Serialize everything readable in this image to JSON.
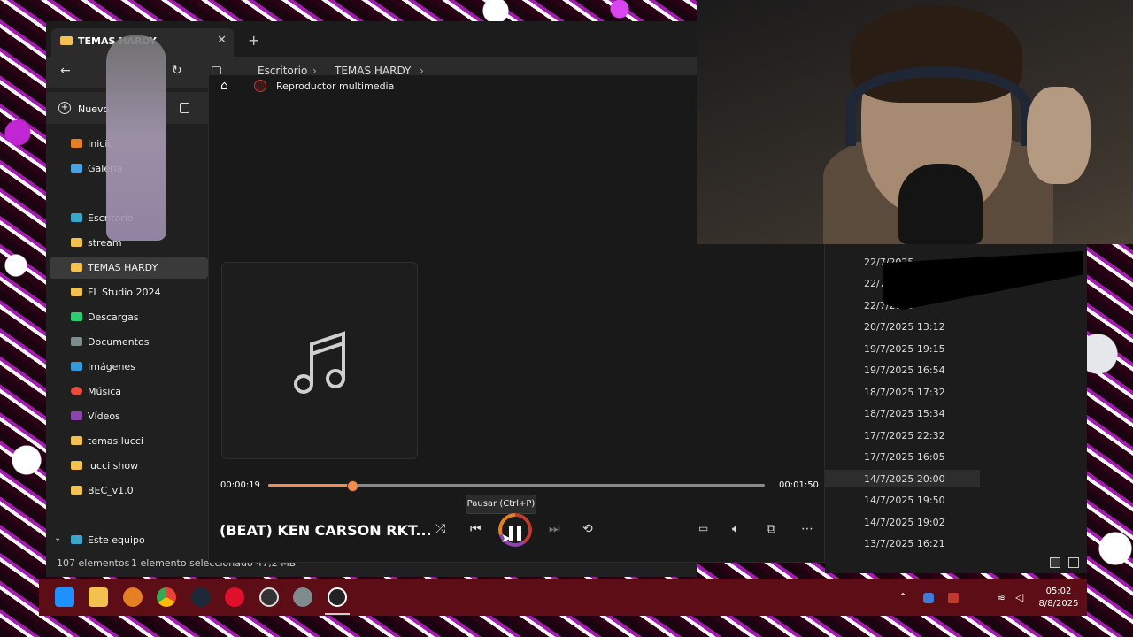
{
  "explorer": {
    "tab_title": "TEMAS HARDY",
    "close_glyph": "✕",
    "newtab_glyph": "+",
    "breadcrumb": [
      "Escritorio",
      "TEMAS HARDY"
    ],
    "new_button": "Nuevo",
    "sidebar": [
      "Inicio",
      "Galería",
      "Escritorio",
      "stream",
      "TEMAS HARDY",
      "FL Studio 2024",
      "Descargas",
      "Documentos",
      "Imágenes",
      "Música",
      "Vídeos",
      "temas lucci",
      "lucci show",
      "BEC_v1.0",
      "Este equipo"
    ],
    "status_count": "107 elementos",
    "status_selected": "1 elemento seleccionado  47,2 MB",
    "dates": [
      "22/7/2025",
      "22/7/2025",
      "22/7/2025",
      "20/7/2025 13:12",
      "19/7/2025 19:15",
      "19/7/2025 16:54",
      "18/7/2025 17:32",
      "18/7/2025 15:34",
      "17/7/2025 22:32",
      "17/7/2025 16:05",
      "14/7/2025 20:00",
      "14/7/2025 19:50",
      "14/7/2025 19:02",
      "13/7/2025 16:21"
    ]
  },
  "player": {
    "app_title": "Reproductor multimedia",
    "elapsed": "00:00:19",
    "duration": "00:01:50",
    "progress_fraction": 0.17,
    "tooltip": "Pausar (Ctrl+P)",
    "song_title": "(BEAT) KEN CARSON RKT..."
  },
  "taskbar": {
    "time": "05:02",
    "date": "8/8/2025"
  },
  "colors": {
    "accent": "#f28a52",
    "taskbar": "#5c0d15",
    "folder": "#f2c14e"
  }
}
